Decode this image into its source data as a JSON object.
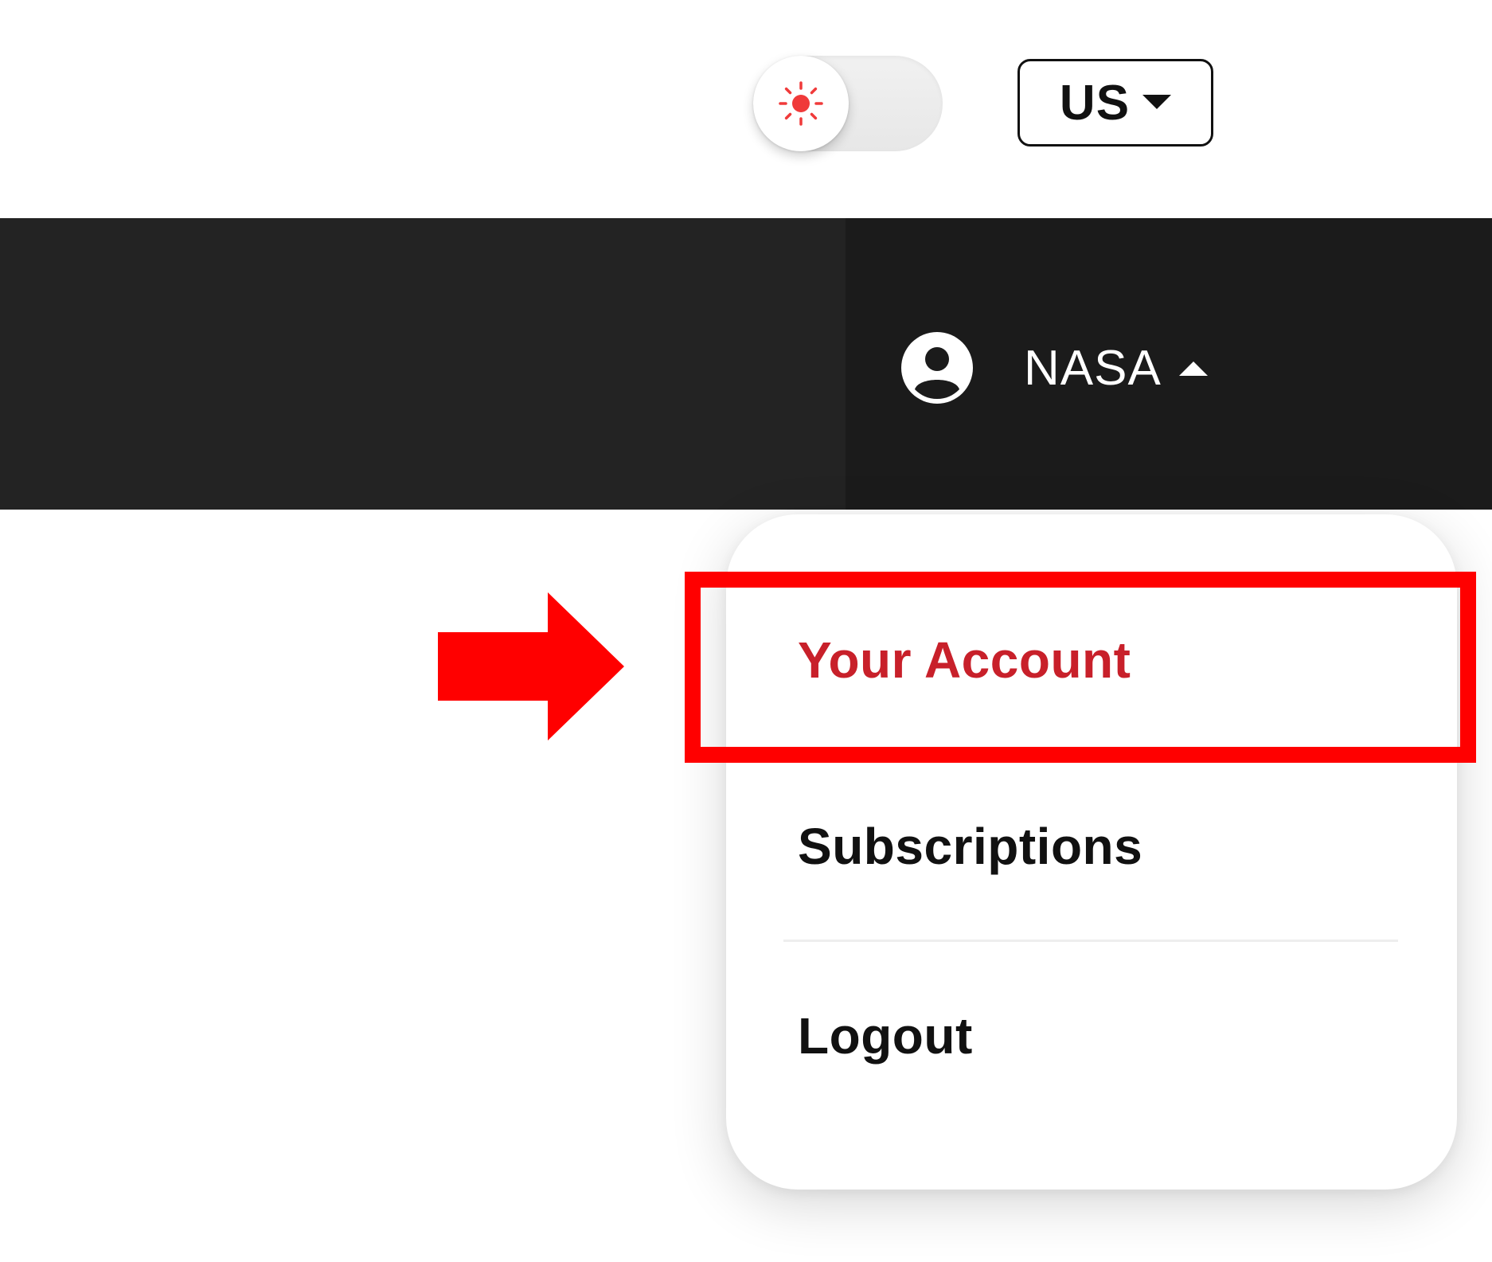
{
  "topbar": {
    "theme_toggle": {
      "mode": "light",
      "icon": "sun-icon",
      "icon_color": "#f03a3a"
    },
    "region_selector": {
      "label": "US",
      "icon": "caret-down-icon"
    }
  },
  "navbar": {
    "user_menu": {
      "avatar_icon": "user-circle-icon",
      "username": "NASA",
      "state": "expanded",
      "icon": "caret-up-icon"
    }
  },
  "dropdown": {
    "items": [
      {
        "label": "Your Account",
        "active": true
      },
      {
        "label": "Subscriptions",
        "active": false
      },
      {
        "label": "Logout",
        "active": false
      }
    ]
  },
  "annotation": {
    "highlighted_item": "Your Account",
    "color": "#ff0000",
    "arrow_icon": "arrow-right-icon"
  },
  "colors": {
    "navbar_bg": "#232323",
    "accent": "#c8202a",
    "text_dark": "#111111"
  }
}
